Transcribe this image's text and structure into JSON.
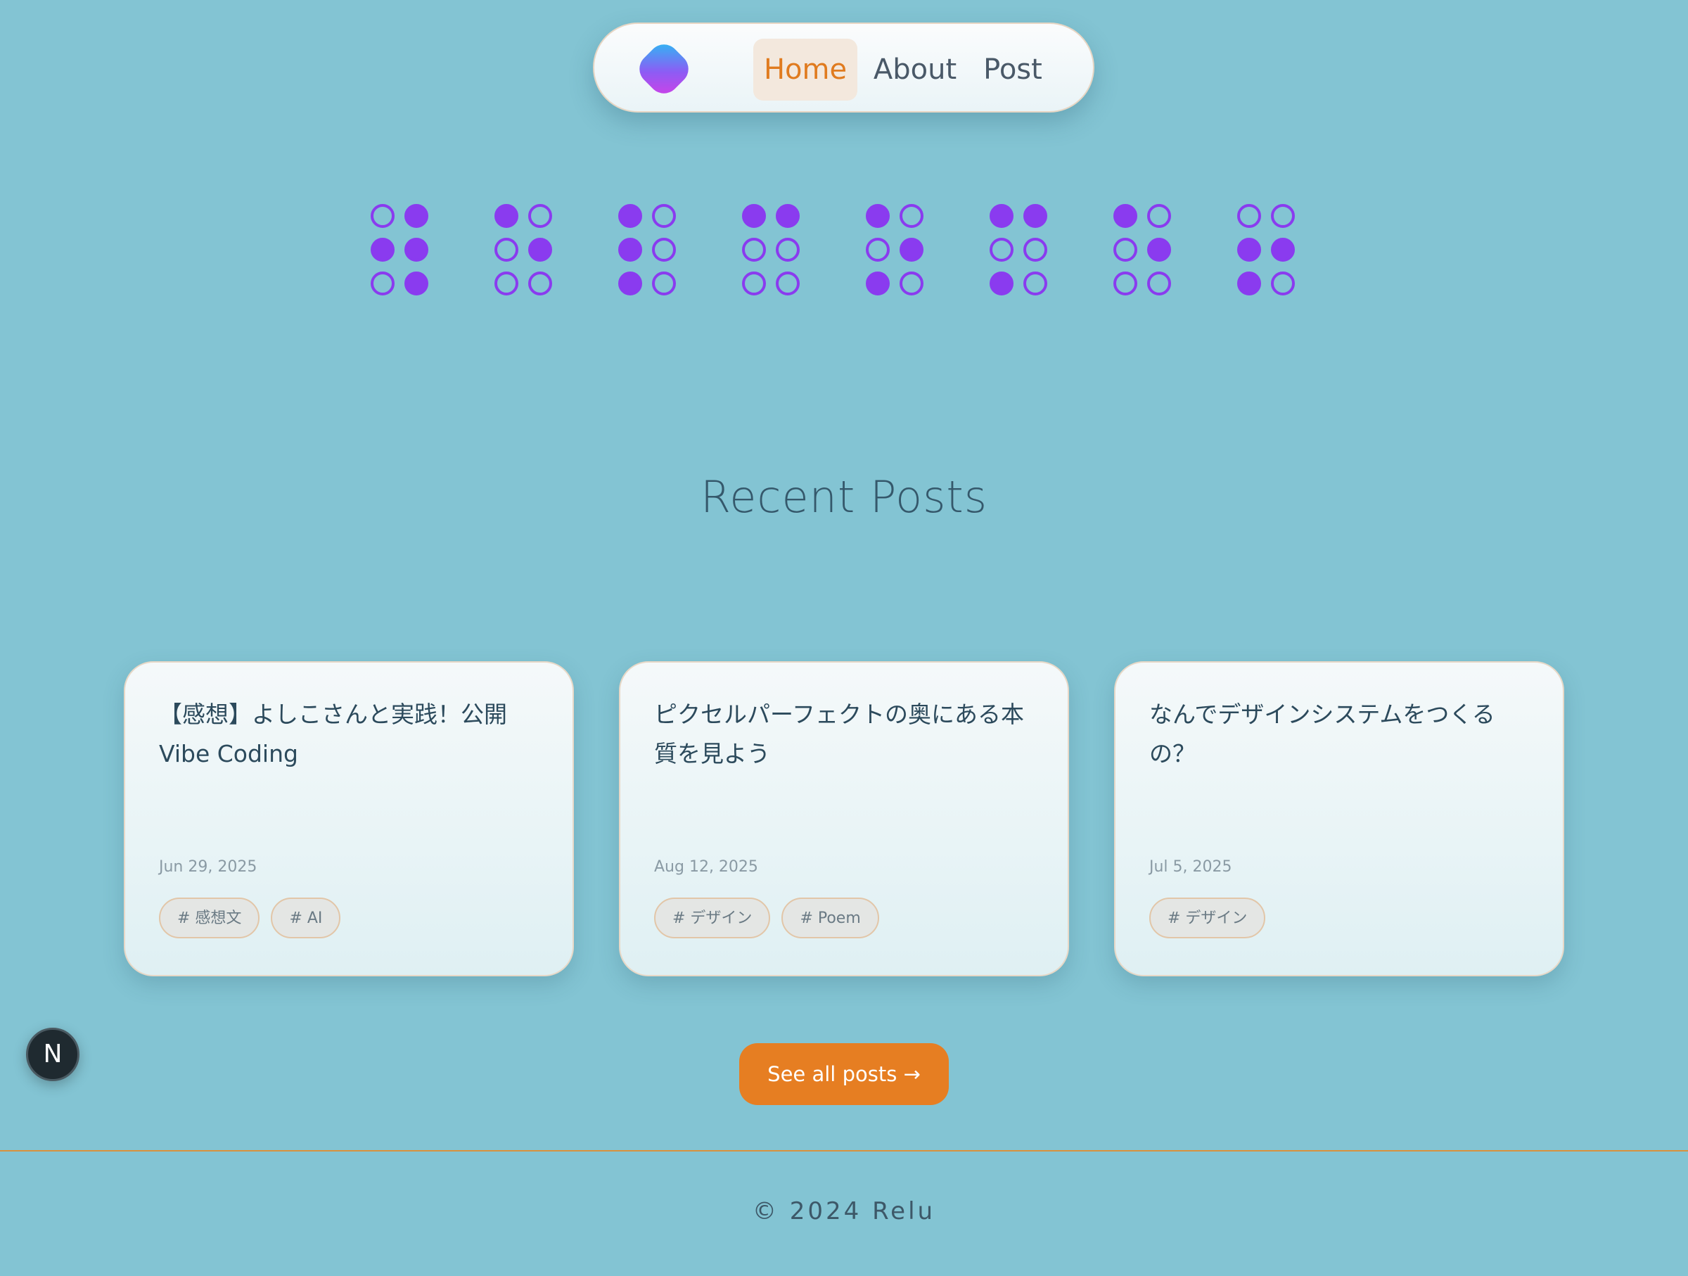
{
  "nav": {
    "logo_icon": "rounded-diamond-gradient-logo",
    "items": [
      {
        "label": "Home",
        "active": true
      },
      {
        "label": "About",
        "active": false
      },
      {
        "label": "Post",
        "active": false
      }
    ]
  },
  "braille": {
    "dot_color": "#8a3bef",
    "cells": [
      [
        0,
        1,
        1,
        1,
        0,
        1
      ],
      [
        1,
        0,
        0,
        1,
        0,
        0
      ],
      [
        1,
        0,
        1,
        0,
        1,
        0
      ],
      [
        1,
        1,
        0,
        0,
        0,
        0
      ],
      [
        1,
        0,
        0,
        1,
        1,
        0
      ],
      [
        1,
        1,
        0,
        0,
        1,
        0
      ],
      [
        1,
        0,
        0,
        1,
        0,
        0
      ],
      [
        0,
        0,
        1,
        1,
        1,
        0
      ]
    ]
  },
  "recent": {
    "title": "Recent Posts"
  },
  "posts": [
    {
      "title": "【感想】よしこさんと実践！公開Vibe Coding",
      "date": "Jun 29, 2025",
      "tags": [
        "# 感想文",
        "# AI"
      ]
    },
    {
      "title": "ピクセルパーフェクトの奥にある本質を見よう",
      "date": "Aug 12, 2025",
      "tags": [
        "# デザイン",
        "# Poem"
      ]
    },
    {
      "title": "なんでデザインシステムをつくるの？",
      "date": "Jul 5, 2025",
      "tags": [
        "# デザイン"
      ]
    }
  ],
  "see_all": {
    "label": "See all posts →"
  },
  "footer": {
    "copyright": "© 2024 Relu"
  },
  "next_badge": {
    "label": "N"
  },
  "colors": {
    "background": "#83c4d3",
    "accent": "#e67e22",
    "active_nav_text": "#e07b1f",
    "braille": "#8a3bef"
  }
}
